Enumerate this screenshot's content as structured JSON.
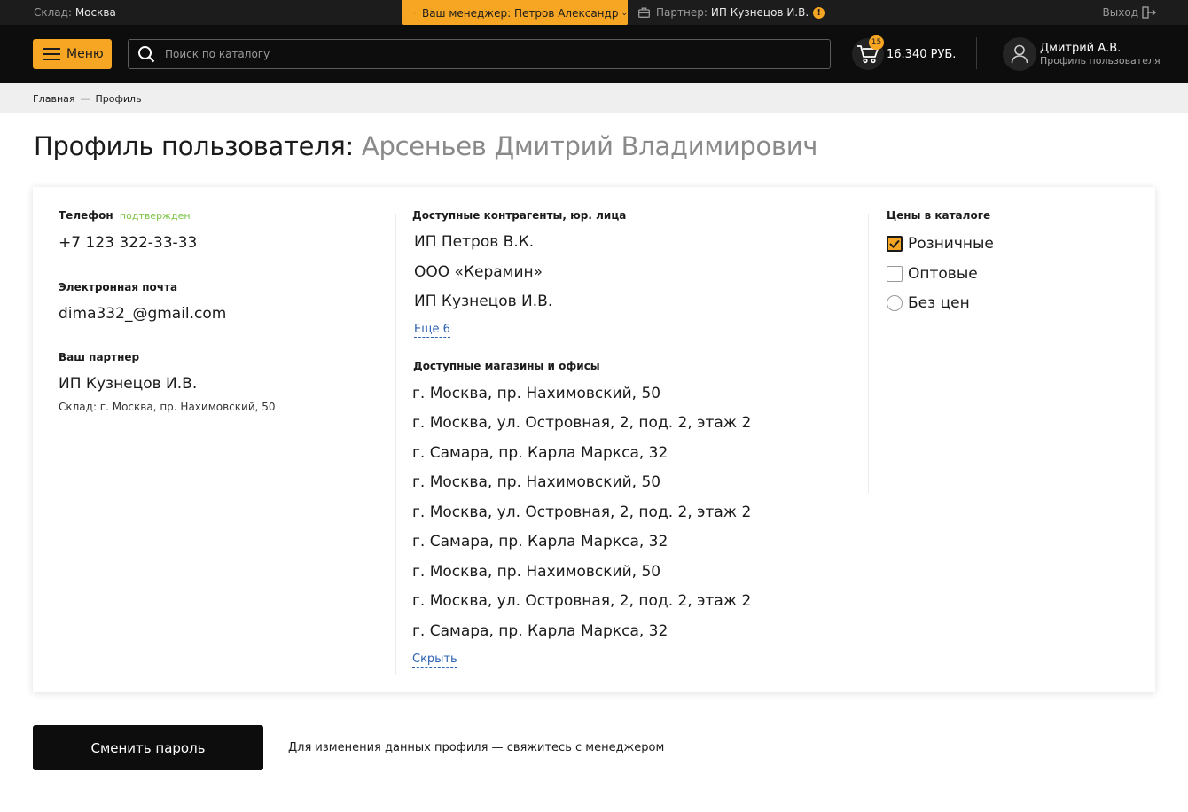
{
  "topbar": {
    "warehouse_label": "Склад:",
    "warehouse_value": "Москва",
    "manager": "Ваш менеджер: Петров Александр",
    "partner_label": "Партнер:",
    "partner_value": "ИП Кузнецов И.В.",
    "partner_warning": "!",
    "logout": "Выход"
  },
  "header": {
    "menu_label": "Меню",
    "search_placeholder": "Поиск по каталогу",
    "search_value": "",
    "cart_count": "15",
    "cart_total": "16.340 РУБ.",
    "user_name": "Дмитрий А.В.",
    "user_sub": "Профиль пользователя"
  },
  "breadcrumbs": [
    {
      "label": "Главная"
    },
    {
      "label": "Профиль"
    }
  ],
  "page": {
    "title_prefix": "Профиль пользователя:",
    "title_name": "Арсеньев Дмитрий Владимирович"
  },
  "profile": {
    "phone_label": "Телефон",
    "phone_status": "подтвержден",
    "phone_value": "+7 123 322-33-33",
    "email_label": "Электронная почта",
    "email_value": "dima332_@gmail.com",
    "partner_label": "Ваш партнер",
    "partner_value": "ИП Кузнецов И.В.",
    "partner_warehouse": "Склад: г. Москва, пр. Нахимовский, 50"
  },
  "counterparties": {
    "label": "Доступные контрагенты, юр. лица",
    "items": [
      "ИП Петров В.К.",
      "ООО «Керамин»",
      "ИП Кузнецов И.В."
    ],
    "more_link": "Еще 6"
  },
  "stores": {
    "label": "Доступные магазины и офисы",
    "items": [
      "г. Москва, пр. Нахимовский, 50",
      "г. Москва, ул. Островная, 2, под. 2, этаж 2",
      "г. Самара, пр. Карла Маркса, 32",
      "г. Москва, пр. Нахимовский, 50",
      "г. Москва, ул. Островная, 2, под. 2, этаж 2",
      "г. Самара, пр. Карла Маркса, 32",
      "г. Москва, пр. Нахимовский, 50",
      "г. Москва, ул. Островная, 2, под. 2, этаж 2",
      "г. Самара, пр. Карла Маркса, 32"
    ],
    "hide_link": "Скрыть"
  },
  "prices": {
    "label": "Цены в каталоге",
    "options": [
      {
        "label": "Розничные",
        "checked": true,
        "control": "checkbox"
      },
      {
        "label": "Оптовые",
        "checked": false,
        "control": "checkbox"
      },
      {
        "label": "Без цен",
        "checked": false,
        "control": "radio"
      }
    ]
  },
  "footer": {
    "change_password": "Сменить пароль",
    "note": "Для изменения данных профиля — свяжитесь с менеджером"
  },
  "colors": {
    "accent": "#f6a623",
    "header_bg": "#0d0d0d",
    "confirmed": "#7cc245",
    "link": "#2e62b4"
  }
}
